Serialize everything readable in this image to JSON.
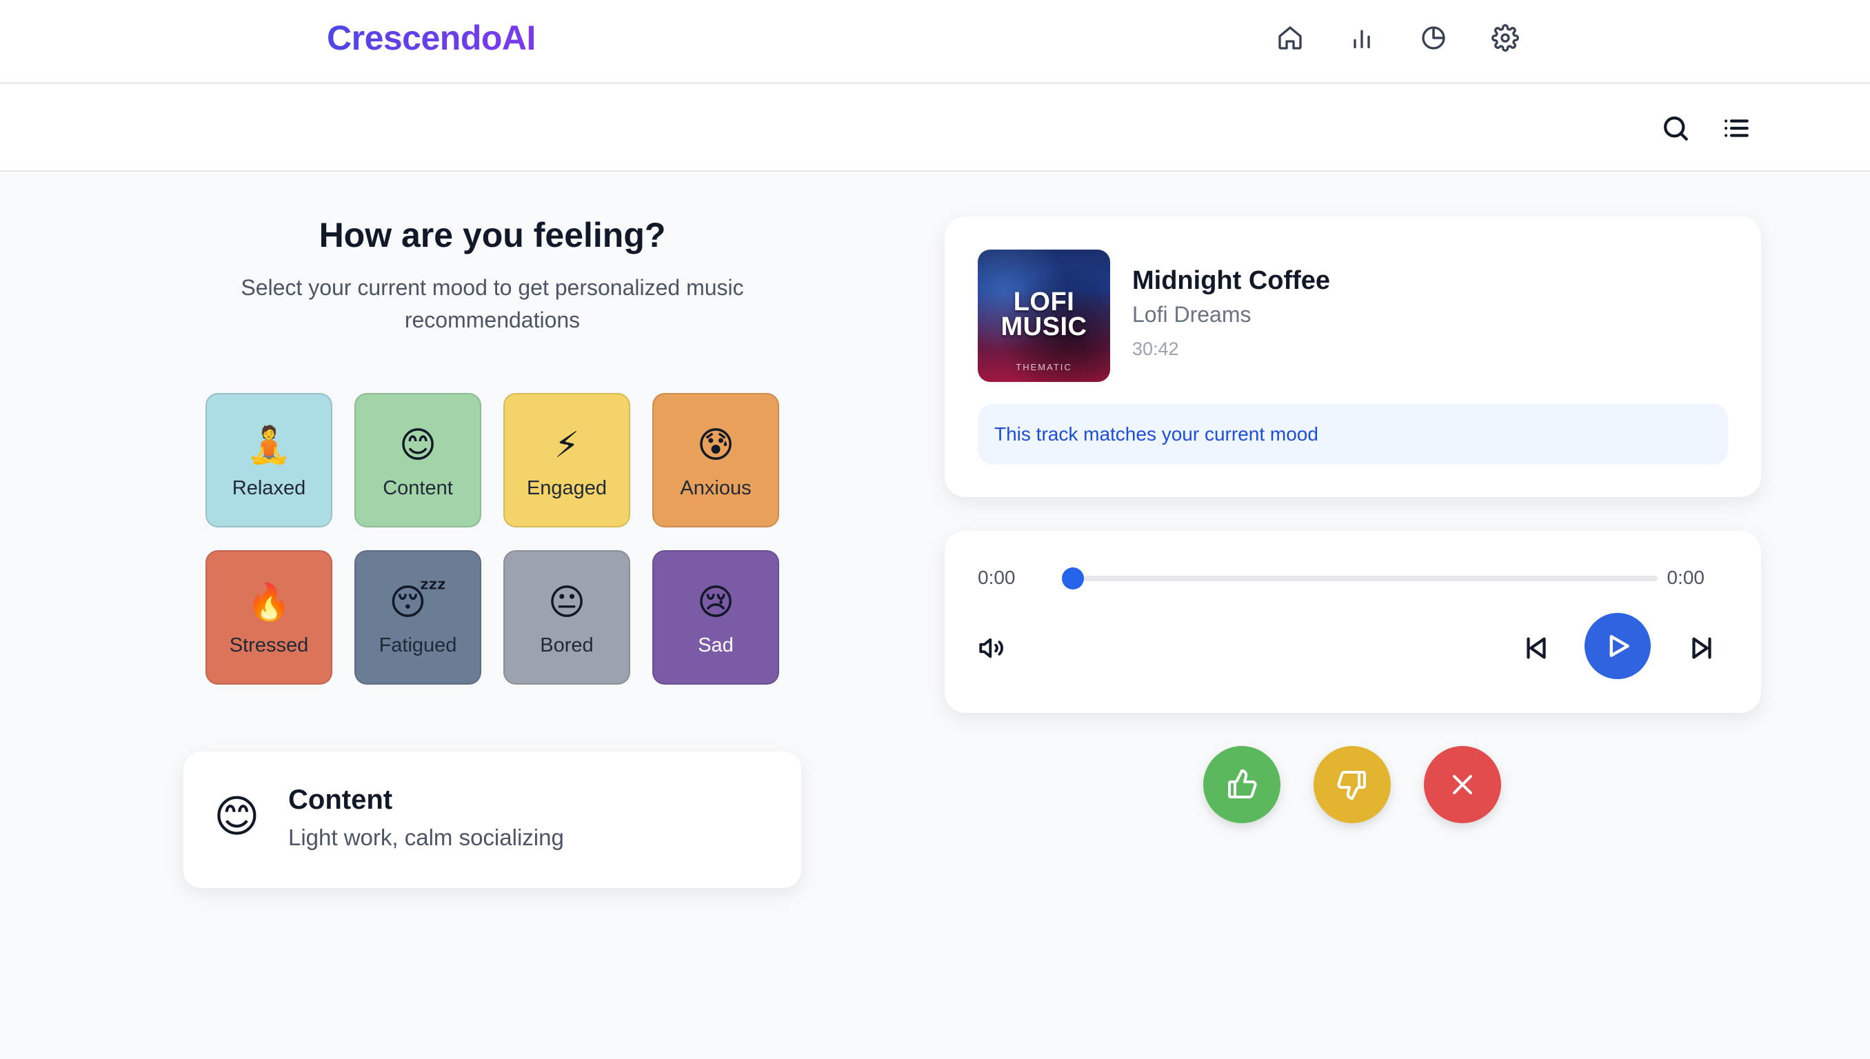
{
  "app": {
    "title": "CrescendoAI"
  },
  "nav": [
    {
      "name": "home",
      "icon": "home-icon"
    },
    {
      "name": "stats",
      "icon": "bar-chart-icon"
    },
    {
      "name": "insights",
      "icon": "pie-chart-icon"
    },
    {
      "name": "settings",
      "icon": "gear-icon"
    }
  ],
  "toolbar": {
    "search_icon": "search-icon",
    "list_icon": "list-icon"
  },
  "mood_section": {
    "title": "How are you feeling?",
    "subtitle": "Select your current mood to get personalized music recommendations",
    "moods": [
      {
        "label": "Relaxed",
        "emoji": "🧘",
        "color": "#acdce4",
        "text_color": "#1f2937"
      },
      {
        "label": "Content",
        "emoji": "😊",
        "color": "#a3d4a8",
        "text_color": "#1f2937"
      },
      {
        "label": "Engaged",
        "emoji": "⚡",
        "color": "#f4d468",
        "text_color": "#1f2937"
      },
      {
        "label": "Anxious",
        "emoji": "😰",
        "color": "#e9a05a",
        "text_color": "#1f2937"
      },
      {
        "label": "Stressed",
        "emoji": "🔥",
        "color": "#dc7459",
        "text_color": "#1f2937"
      },
      {
        "label": "Fatigued",
        "emoji": "😴",
        "color": "#6b7c95",
        "text_color": "#1f2937"
      },
      {
        "label": "Bored",
        "emoji": "😐",
        "color": "#9ca3af",
        "text_color": "#1f2937"
      },
      {
        "label": "Sad",
        "emoji": "😢",
        "color": "#7b5aa6",
        "text_color": "#ffffff"
      }
    ]
  },
  "current_mood": {
    "emoji": "😊",
    "title": "Content",
    "description": "Light work, calm socializing"
  },
  "track": {
    "cover_text": "LOFI MUSIC",
    "cover_brand": "THEMATIC",
    "title": "Midnight Coffee",
    "artist": "Lofi Dreams",
    "duration": "30:42",
    "match_message": "This track matches your current mood"
  },
  "player": {
    "current_time": "0:00",
    "total_time": "0:00",
    "progress": 0
  },
  "feedback": [
    {
      "name": "like",
      "icon": "thumbs-up-icon",
      "color": "#5cb85c"
    },
    {
      "name": "dislike",
      "icon": "thumbs-down-icon",
      "color": "#e2b42f"
    },
    {
      "name": "skip",
      "icon": "close-icon",
      "color": "#e24c4c"
    }
  ],
  "colors": {
    "accent": "#2563eb",
    "brand_gradient_start": "#4f46e5",
    "brand_gradient_end": "#7c3aed"
  }
}
